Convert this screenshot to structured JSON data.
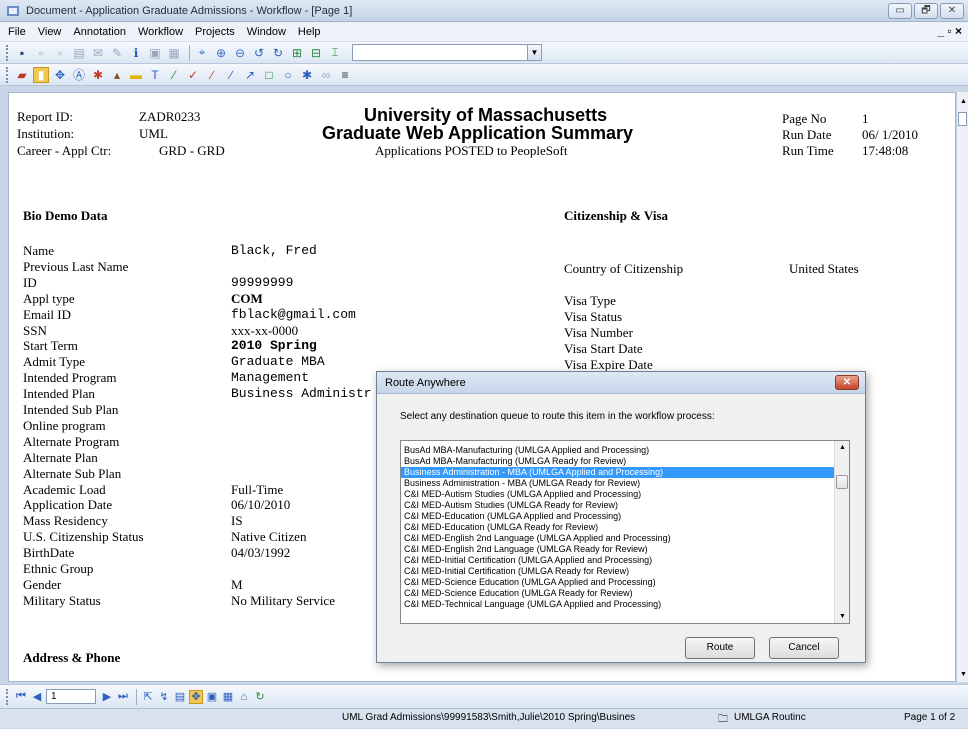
{
  "window": {
    "title": "Document - Application Graduate Admissions - Workflow - [Page 1]",
    "controls": [
      "▭",
      "🗗",
      "✕"
    ]
  },
  "menu": {
    "items": [
      "File",
      "View",
      "Annotation",
      "Workflow",
      "Projects",
      "Window",
      "Help"
    ],
    "mdi_controls": "_ ▫ ×"
  },
  "report": {
    "header_left": [
      {
        "label": "Report ID:",
        "value": "ZADR0233"
      },
      {
        "label": "Institution:",
        "value": "UML"
      },
      {
        "label": "Career - Appl Ctr:",
        "value": "GRD -  GRD"
      }
    ],
    "title1": "University of Massachusetts",
    "title2": "Graduate  Web Application Summary",
    "subtitle": "Applications POSTED to PeopleSoft",
    "header_right": [
      {
        "label": "Page No",
        "value": "1"
      },
      {
        "label": "Run Date",
        "value": "06/ 1/2010"
      },
      {
        "label": "Run Time",
        "value": "17:48:08"
      }
    ],
    "bio_heading": "Bio Demo Data",
    "citizenship_heading": "Citizenship & Visa",
    "address_heading": "Address & Phone",
    "bio_rows": [
      {
        "label": "Name",
        "value": "Black, Fred"
      },
      {
        "label": "Previous Last Name",
        "value": ""
      },
      {
        "label": "ID",
        "value": "99999999"
      },
      {
        "label": "Appl type",
        "value": "COM"
      },
      {
        "label": "Email ID",
        "value": "fblack@gmail.com"
      },
      {
        "label": "SSN",
        "value": "xxx-xx-0000"
      },
      {
        "label": "Start Term",
        "value": "2010 Spring"
      },
      {
        "label": "Admit Type",
        "value": "Graduate MBA"
      },
      {
        "label": "Intended Program",
        "value": "Management"
      },
      {
        "label": "Intended Plan",
        "value": "Business Administr"
      },
      {
        "label": "Intended Sub Plan",
        "value": ""
      },
      {
        "label": "Online program",
        "value": ""
      },
      {
        "label": "Alternate Program",
        "value": ""
      },
      {
        "label": "Alternate Plan",
        "value": ""
      },
      {
        "label": "Alternate Sub Plan",
        "value": ""
      },
      {
        "label": "Academic Load",
        "value": "Full-Time"
      },
      {
        "label": "Application Date",
        "value": "06/10/2010"
      },
      {
        "label": "Mass Residency",
        "value": "IS"
      },
      {
        "label": "U.S. Citizenship Status",
        "value": "Native Citizen"
      },
      {
        "label": "BirthDate",
        "value": "04/03/1992"
      },
      {
        "label": "Ethnic Group",
        "value": ""
      },
      {
        "label": "Gender",
        "value": "M"
      },
      {
        "label": "Military Status",
        "value": "No Military Service"
      }
    ],
    "citizenship_rows": [
      {
        "label": "Country of Citizenship",
        "value": "United States"
      },
      {
        "label": "Visa Type",
        "value": ""
      },
      {
        "label": "Visa Status",
        "value": ""
      },
      {
        "label": "Visa Number",
        "value": ""
      },
      {
        "label": "Visa Start Date",
        "value": ""
      },
      {
        "label": "Visa Expire Date",
        "value": ""
      }
    ]
  },
  "dialog": {
    "title": "Route Anywhere",
    "prompt": "Select any destination queue to route this item in the workflow process:",
    "items": [
      "BusAd MBA-Manufacturing (UMLGA Applied and Processing)",
      "BusAd MBA-Manufacturing (UMLGA Ready for Review)",
      "Business Administration - MBA (UMLGA Applied and Processing)",
      "Business Administration - MBA (UMLGA Ready for Review)",
      "C&I MED-Autism Studies (UMLGA Applied and Processing)",
      "C&I MED-Autism Studies (UMLGA Ready for Review)",
      "C&I MED-Education (UMLGA Applied and Processing)",
      "C&I MED-Education (UMLGA Ready for Review)",
      "C&I MED-English 2nd Language (UMLGA Applied and Processing)",
      "C&I MED-English 2nd Language (UMLGA Ready for Review)",
      "C&I MED-Initial Certification (UMLGA Applied and Processing)",
      "C&I MED-Initial Certification (UMLGA Ready for Review)",
      "C&I MED-Science Education (UMLGA Applied and Processing)",
      "C&I MED-Science Education (UMLGA Ready for Review)",
      "C&I MED-Technical Language (UMLGA Applied and Processing)"
    ],
    "selected_index": 2,
    "route_label": "Route",
    "cancel_label": "Cancel"
  },
  "nav": {
    "page_value": "1"
  },
  "status": {
    "path": "UML Grad Admissions\\99991583\\Smith,Julie\\2010 Spring\\Busines",
    "queue": "UMLGA Routinc",
    "pages": "Page 1 of 2"
  }
}
